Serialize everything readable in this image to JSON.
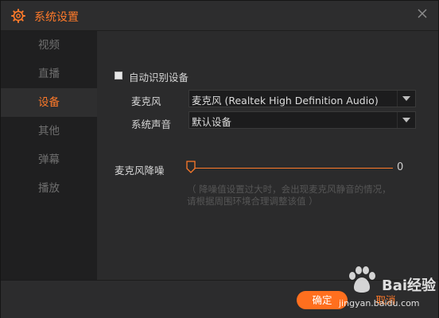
{
  "window": {
    "title": "系统设置",
    "accent_color": "#ff7a2a"
  },
  "icons": {
    "title": "gear-icon",
    "close": "close-icon",
    "slider_thumb": "slider-thumb-icon",
    "watermark": "paw-icon"
  },
  "sidebar": {
    "items": [
      {
        "label": "视频",
        "active": false
      },
      {
        "label": "直播",
        "active": false
      },
      {
        "label": "设备",
        "active": true
      },
      {
        "label": "其他",
        "active": false
      },
      {
        "label": "弹幕",
        "active": false
      },
      {
        "label": "播放",
        "active": false
      }
    ]
  },
  "device": {
    "auto_detect_label": "自动识别设备",
    "auto_detect_checked": false,
    "mic_label": "麦克风",
    "mic_value": "麦克风 (Realtek High Definition Audio)",
    "system_sound_label": "系统声音",
    "system_sound_value": "默认设备",
    "noise_label": "麦克风降噪",
    "noise_value": "0",
    "hint_line1": "（ 降噪值设置过大时，会出现麦克风静音的情况，",
    "hint_line2": "请根据周围环境合理调整该值 ）"
  },
  "footer": {
    "ok_label": "确定",
    "cancel_label": "取消"
  },
  "watermark": {
    "brand": "Bai",
    "brand_suffix": "经验",
    "url": "jingyan.baidu.com"
  }
}
